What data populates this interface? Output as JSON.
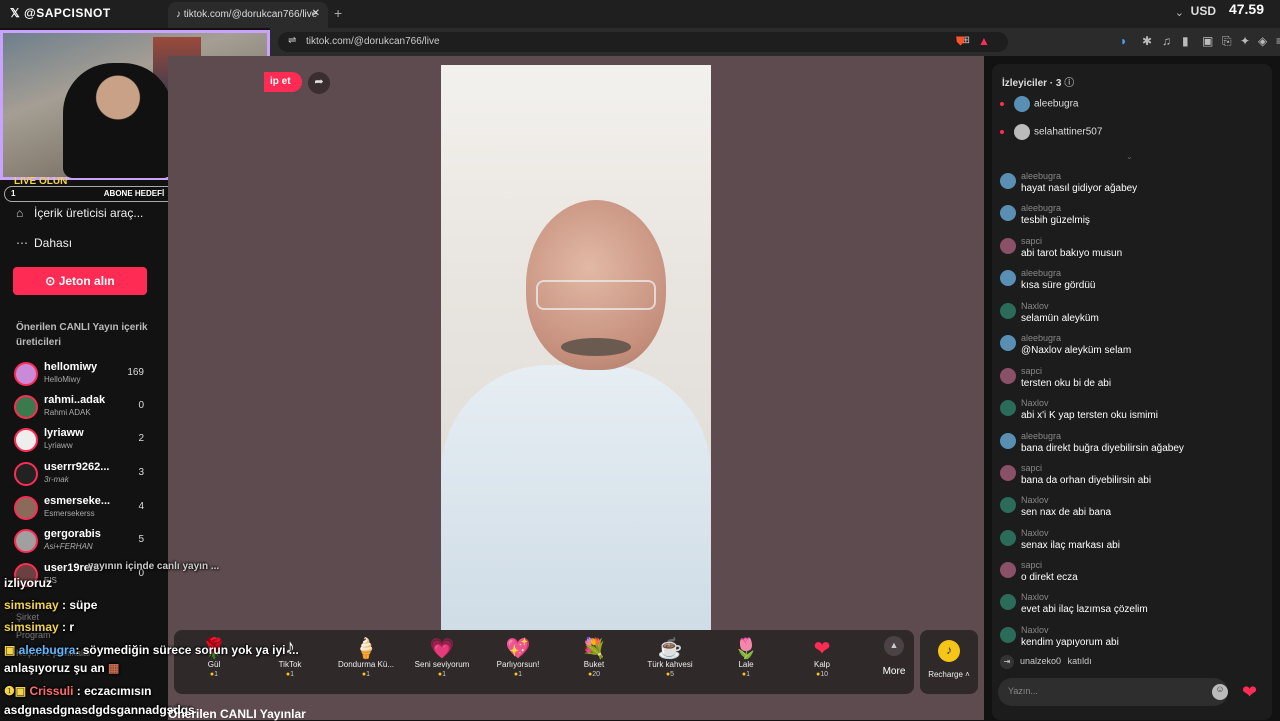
{
  "browser": {
    "brand": "@SAPCISNOT",
    "tab_title": "tiktok.com/@dorukcan766/live",
    "new_tab": "+",
    "url": "tiktok.com/@dorukcan766/live",
    "currency": "USD",
    "currency_value": "47.59"
  },
  "stream_overlay": {
    "goal_left": "1",
    "goal_label": "ABONE HEDEFİ",
    "goal_right": "10",
    "live_text": "LIVE OLUN"
  },
  "sidebar": {
    "items": [
      {
        "icon": "content-creator-icon",
        "label": "İçerik üreticisi araç..."
      },
      {
        "icon": "more-icon",
        "label": "Dahası"
      }
    ],
    "coin_button": "Jeton alın",
    "suggested_title": "Önerilen CANLI Yayın içerik üreticileri",
    "creators": [
      {
        "name": "hellomiwy",
        "sub": "HelloMiwy",
        "count": "169"
      },
      {
        "name": "rahmi..adak",
        "sub": "Rahmi ADAK",
        "count": "0"
      },
      {
        "name": "lyriaww",
        "sub": "Lyriaww",
        "count": "2"
      },
      {
        "name": "userrr9262...",
        "sub": "3r-mak",
        "count": "3"
      },
      {
        "name": "esmerseke...",
        "sub": "Esmersekerss",
        "count": "4"
      },
      {
        "name": "gergorabis",
        "sub": "Asi+FERHAN",
        "count": "5"
      },
      {
        "name": "user19reis",
        "sub": "EIS",
        "count": "0"
      }
    ],
    "ghost_items": [
      "Şirket",
      "Program",
      "Koşul ve politikalar"
    ]
  },
  "overlay_chat": [
    {
      "user": "",
      "text": "yayının içinde canlı yayın ..."
    },
    {
      "user": "",
      "text": "izliyoruz"
    },
    {
      "user": "simsimay",
      "text": ": süpe"
    },
    {
      "user": "simsimay",
      "text": ": r"
    },
    {
      "user": "aleebugra",
      "text": ": söymediğin sürece sorun yok ya iyi ..."
    },
    {
      "user": "",
      "text": "anlaşıyoruz şu an"
    },
    {
      "user": "Crissuli",
      "text": ": eczacımısın"
    },
    {
      "user": "",
      "text": "asdgnasdgnasdgdsgannadgsdgs"
    }
  ],
  "stage": {
    "tip_label": "ip et",
    "bottom_title": "Önerilen CANLI Yayınlar"
  },
  "gifts": [
    {
      "icon": "rose-icon",
      "glyph": "🌹",
      "name": "Gül",
      "price": "1"
    },
    {
      "icon": "tiktok-gift-icon",
      "glyph": "♪",
      "name": "TikTok",
      "price": "1"
    },
    {
      "icon": "ice-cream-icon",
      "glyph": "🍦",
      "name": "Dondurma Kü...",
      "price": "1"
    },
    {
      "icon": "love-you-icon",
      "glyph": "💗",
      "name": "Seni seviyorum",
      "price": "1"
    },
    {
      "icon": "sparkle-heart-icon",
      "glyph": "💖",
      "name": "Parlıyorsun!",
      "price": "1"
    },
    {
      "icon": "bouquet-icon",
      "glyph": "💐",
      "name": "Buket",
      "price": "20"
    },
    {
      "icon": "coffee-icon",
      "glyph": "☕",
      "name": "Türk kahvesi",
      "price": "5"
    },
    {
      "icon": "tulip-icon",
      "glyph": "🌷",
      "name": "Lale",
      "price": "1"
    },
    {
      "icon": "heart-icon",
      "glyph": "❤",
      "name": "Kalp",
      "price": "10"
    }
  ],
  "gift_more": "More",
  "recharge": "Recharge",
  "chat": {
    "viewers_title": "İzleyiciler · 3",
    "viewers": [
      "aleebugra",
      "selahattiner507"
    ],
    "messages": [
      {
        "user": "aleebugra",
        "text": "hayat nasıl gidiyor ağabey"
      },
      {
        "user": "aleebugra",
        "text": "tesbih güzelmiş"
      },
      {
        "user": "sapci",
        "text": "abi tarot bakıyo musun"
      },
      {
        "user": "aleebugra",
        "text": "kısa süre gördüü"
      },
      {
        "user": "Naxlov",
        "text": "selamün aleyküm"
      },
      {
        "user": "aleebugra",
        "text": "@Naxlov aleyküm selam"
      },
      {
        "user": "sapci",
        "text": "tersten oku bi de abi"
      },
      {
        "user": "Naxlov",
        "text": "abi x'i K yap tersten oku ismimi"
      },
      {
        "user": "aleebugra",
        "text": "bana direkt buğra diyebilirsin ağabey"
      },
      {
        "user": "sapci",
        "text": "bana da orhan diyebilirsin abi"
      },
      {
        "user": "Naxlov",
        "text": "sen nax de abi bana"
      },
      {
        "user": "Naxlov",
        "text": "senax ilaç markası abi"
      },
      {
        "user": "sapci",
        "text": "o direkt ecza"
      },
      {
        "user": "Naxlov",
        "text": "evet abi ilaç lazımsa çözelim"
      },
      {
        "user": "Naxlov",
        "text": "kendim yapıyorum abi"
      }
    ],
    "joined_user": "unalzeko0",
    "joined_text": "katıldı",
    "input_placeholder": "Yazın..."
  }
}
